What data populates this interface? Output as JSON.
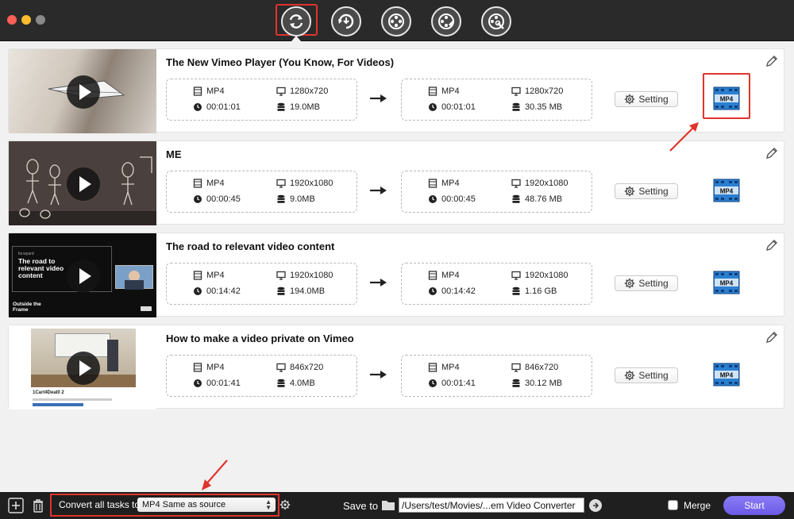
{
  "app": {
    "toolbar": {
      "tools": [
        {
          "name": "convert-tool",
          "icon": "convert-icon",
          "selected": true
        },
        {
          "name": "download-tool",
          "icon": "download-icon",
          "selected": false
        },
        {
          "name": "film-reel-tool",
          "icon": "film-reel-icon",
          "selected": false
        },
        {
          "name": "film-edit-tool",
          "icon": "film-edit-icon",
          "selected": false
        },
        {
          "name": "film-tools-tool",
          "icon": "film-tools-icon",
          "selected": false
        }
      ]
    }
  },
  "tasks": [
    {
      "title": "The New Vimeo Player (You Know, For Videos)",
      "source": {
        "format": "MP4",
        "resolution": "1280x720",
        "duration": "00:01:01",
        "size": "19.0MB"
      },
      "output": {
        "format": "MP4",
        "resolution": "1280x720",
        "duration": "00:01:01",
        "size": "30.35 MB"
      },
      "setting_label": "Setting",
      "output_format_badge": "MP4"
    },
    {
      "title": "ME",
      "source": {
        "format": "MP4",
        "resolution": "1920x1080",
        "duration": "00:00:45",
        "size": "9.0MB"
      },
      "output": {
        "format": "MP4",
        "resolution": "1920x1080",
        "duration": "00:00:45",
        "size": "48.76 MB"
      },
      "setting_label": "Setting",
      "output_format_badge": "MP4"
    },
    {
      "title": "The road to relevant video content",
      "thumb_text": {
        "brand": "bv.wyard",
        "headline": "The road to relevant video content",
        "footer": "Outside the Frame"
      },
      "source": {
        "format": "MP4",
        "resolution": "1920x1080",
        "duration": "00:14:42",
        "size": "194.0MB"
      },
      "output": {
        "format": "MP4",
        "resolution": "1920x1080",
        "duration": "00:14:42",
        "size": "1.16 GB"
      },
      "setting_label": "Setting",
      "output_format_badge": "MP4"
    },
    {
      "title": "How to make a video private on Vimeo",
      "thumb_text": {
        "caption": "1Cart4Deal0 2"
      },
      "source": {
        "format": "MP4",
        "resolution": "846x720",
        "duration": "00:01:41",
        "size": "4.0MB"
      },
      "output": {
        "format": "MP4",
        "resolution": "846x720",
        "duration": "00:01:41",
        "size": "30.12 MB"
      },
      "setting_label": "Setting",
      "output_format_badge": "MP4"
    }
  ],
  "bottombar": {
    "convert_label": "Convert all tasks to",
    "convert_value": "MP4 Same as source",
    "save_label": "Save to",
    "save_path": "/Users/test/Movies/...em Video Converter",
    "merge_label": "Merge",
    "merge_checked": false,
    "start_label": "Start"
  },
  "colors": {
    "accent_red": "#e0332d",
    "start_purple": "#7a6cf0",
    "toolbar_bg": "#2a2a2a"
  }
}
